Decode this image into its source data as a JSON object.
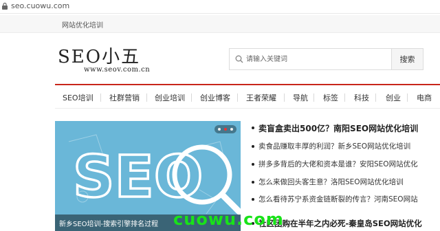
{
  "browser": {
    "url": "seo.cuowu.com"
  },
  "topbar": {
    "link": "网站优化培训"
  },
  "logo": {
    "main": "SEO小五",
    "sub": "www.seov.com.cn"
  },
  "search": {
    "placeholder": "请输入关键词",
    "button": "搜索"
  },
  "nav": {
    "items": [
      "SEO培训",
      "社群营销",
      "创业培训",
      "创业博客",
      "王者荣耀",
      "导航",
      "标签",
      "科技",
      "创业",
      "电商"
    ]
  },
  "banner": {
    "art_text": "SEO",
    "caption": "新乡SEO培训-搜索引擎排名过程"
  },
  "news": {
    "headline": "卖盲盒卖出500亿？南阳SEO网站优化培训",
    "items": [
      "卖食品赚取丰厚的利润？新乡SEO网站优化培训",
      "拼多多背后的大佬和资本是谁？安阳SEO网站优化",
      "怎么来做回头客生意？洛阳SEO网站优化培训",
      "怎么看待苏宁系资金链断裂的传言？河南SEO网站"
    ],
    "bottom_headline": "社区团购在半年之内必死-秦皇岛SEO网站优化"
  },
  "watermark": "cuowu.com",
  "colors": {
    "accent": "#c8261a",
    "watermark": "#19e219",
    "banner_bg": "#6ab7d8"
  }
}
